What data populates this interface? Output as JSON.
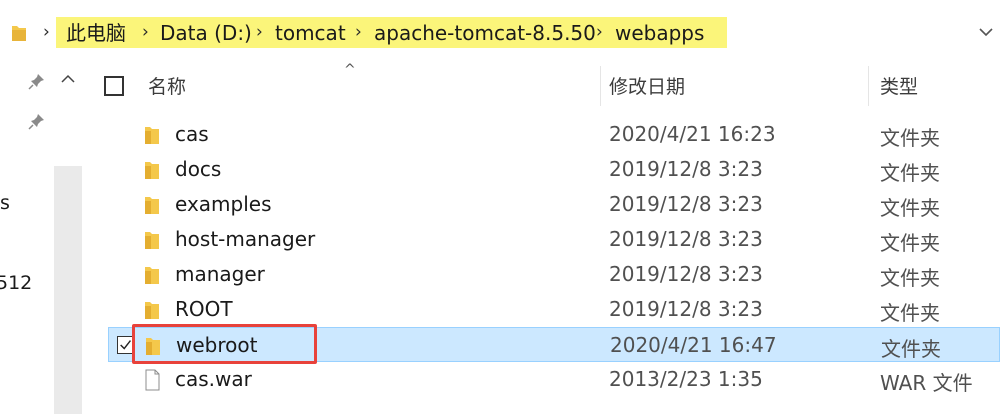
{
  "address_bar": {
    "path": [
      "此电脑",
      "Data (D:)",
      "tomcat",
      "apache-tomcat-8.5.50",
      "webapps"
    ]
  },
  "nav_pane": {
    "clipped_labels": [
      "s",
      "512"
    ]
  },
  "header": {
    "name_label": "名称",
    "date_label": "修改日期",
    "type_label": "类型"
  },
  "files": [
    {
      "name": "cas",
      "date": "2020/4/21 16:23",
      "type": "文件夹",
      "icon": "folder-icon",
      "selected": false
    },
    {
      "name": "docs",
      "date": "2019/12/8 3:23",
      "type": "文件夹",
      "icon": "folder-icon",
      "selected": false
    },
    {
      "name": "examples",
      "date": "2019/12/8 3:23",
      "type": "文件夹",
      "icon": "folder-icon",
      "selected": false
    },
    {
      "name": "host-manager",
      "date": "2019/12/8 3:23",
      "type": "文件夹",
      "icon": "folder-icon",
      "selected": false
    },
    {
      "name": "manager",
      "date": "2019/12/8 3:23",
      "type": "文件夹",
      "icon": "folder-icon",
      "selected": false
    },
    {
      "name": "ROOT",
      "date": "2019/12/8 3:23",
      "type": "文件夹",
      "icon": "folder-icon",
      "selected": false
    },
    {
      "name": "webroot",
      "date": "2020/4/21 16:47",
      "type": "文件夹",
      "icon": "folder-icon",
      "selected": true
    },
    {
      "name": "cas.war",
      "date": "2013/2/23 1:35",
      "type": "WAR 文件",
      "icon": "file-icon",
      "selected": false
    }
  ],
  "colors": {
    "breadcrumb_highlight": "#fbf57a",
    "selection": "#cce8ff",
    "annotation_box": "#e8423b",
    "folder": "#f4c84b"
  }
}
